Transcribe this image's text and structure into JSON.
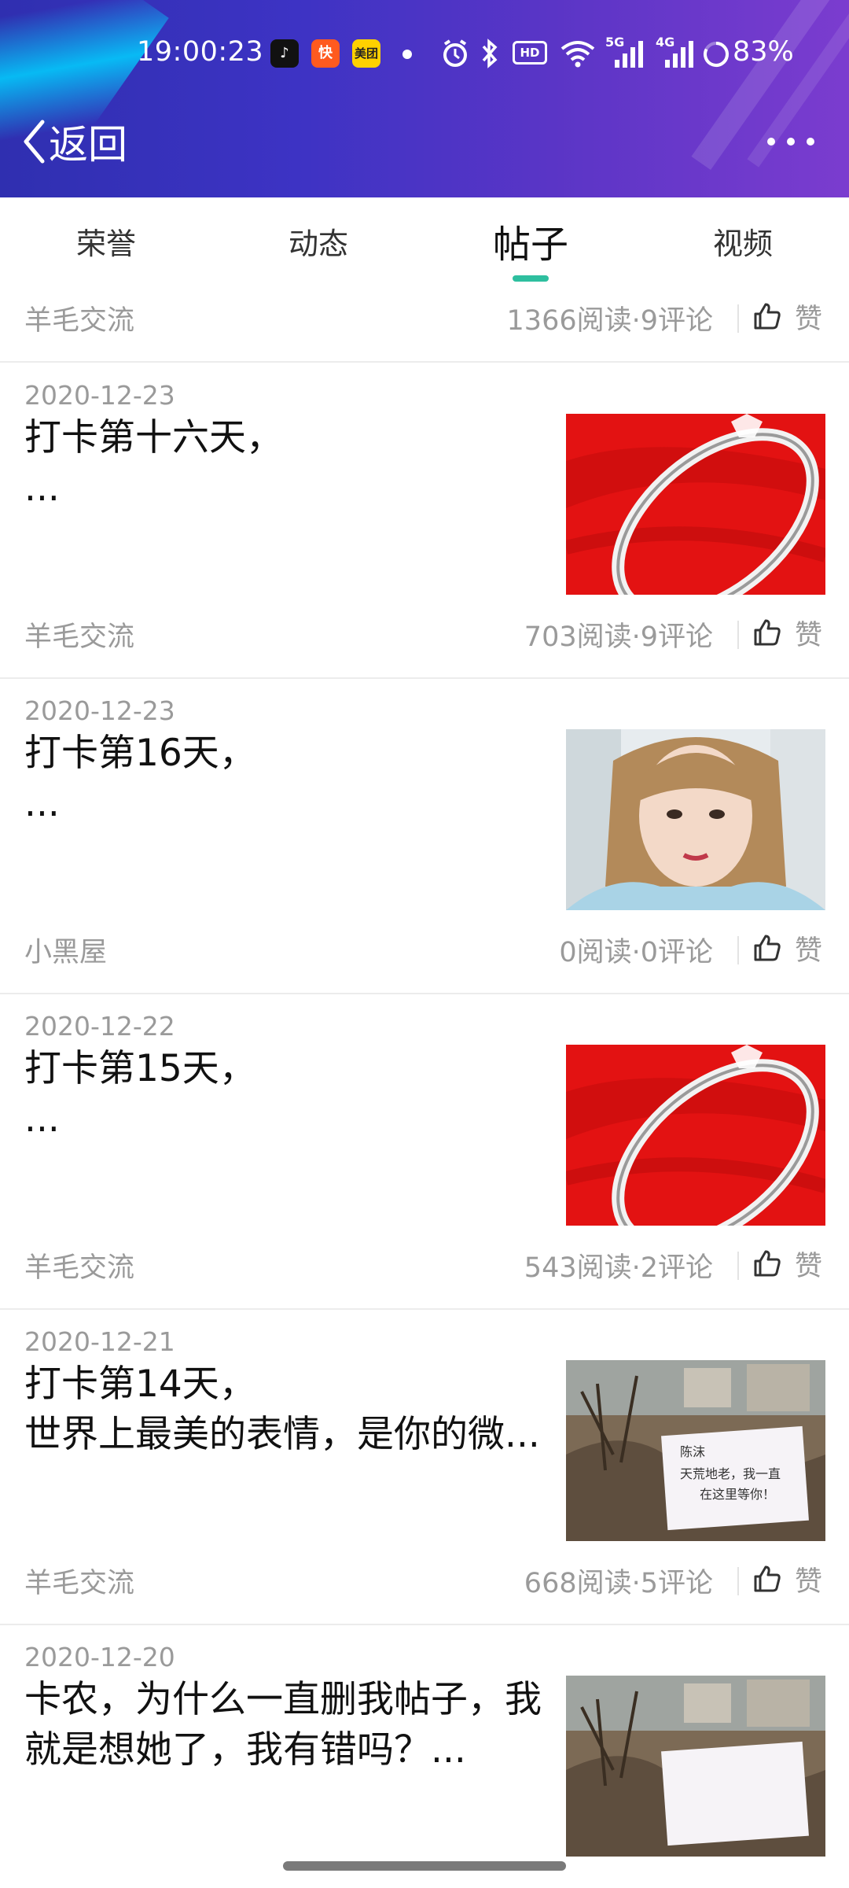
{
  "status_bar": {
    "time": "19:00:23",
    "apps": [
      {
        "name": "douyin-icon",
        "label": "♪",
        "bg": "#111111",
        "fg": "#ffffff"
      },
      {
        "name": "kuaishou-icon",
        "label": "快",
        "bg": "#ff5a1f",
        "fg": "#ffffff"
      },
      {
        "name": "meituan-icon",
        "label": "美团",
        "bg": "#ffd100",
        "fg": "#222222"
      }
    ],
    "hd_label": "HD",
    "network_5g": "5G",
    "network_4g": "4G",
    "battery": "83%"
  },
  "header": {
    "back_label": "返回",
    "gradient_start": "#2f2fb0",
    "gradient_end": "#7b3ccf"
  },
  "tabs": [
    {
      "label": "荣誉",
      "active": false
    },
    {
      "label": "动态",
      "active": false
    },
    {
      "label": "帖子",
      "active": true
    },
    {
      "label": "视频",
      "active": false
    }
  ],
  "accent_color": "#2ebf9f",
  "posts": [
    {
      "date": "",
      "title_line1": "",
      "title_line2": "",
      "thumb": "ring",
      "category": "羊毛交流",
      "stats": "1366阅读·9评论",
      "like_label": "赞"
    },
    {
      "date": "2020-12-23",
      "title_line1": "打卡第十六天，",
      "title_line2": "...",
      "thumb": "ring",
      "category": "羊毛交流",
      "stats": "703阅读·9评论",
      "like_label": "赞"
    },
    {
      "date": "2020-12-23",
      "title_line1": "打卡第16天，",
      "title_line2": "...",
      "thumb": "portrait",
      "category": "小黑屋",
      "stats": "0阅读·0评论",
      "like_label": "赞"
    },
    {
      "date": "2020-12-22",
      "title_line1": "打卡第15天，",
      "title_line2": "...",
      "thumb": "ring",
      "category": "羊毛交流",
      "stats": "543阅读·2评论",
      "like_label": "赞"
    },
    {
      "date": "2020-12-21",
      "title_line1": "打卡第14天，",
      "title_line2": "世界上最美的表情，是你的微...",
      "thumb": "note",
      "category": "羊毛交流",
      "stats": "668阅读·5评论",
      "like_label": "赞"
    },
    {
      "date": "2020-12-20",
      "title_line1": "卡农，为什么一直删我帖子，我",
      "title_line2": "就是想她了，我有错吗？...",
      "thumb": "note",
      "category": "",
      "stats": "",
      "like_label": ""
    }
  ],
  "note_text": {
    "line1": "陈沫",
    "line2": "天荒地老，我一直",
    "line3": "在这里等你！"
  }
}
